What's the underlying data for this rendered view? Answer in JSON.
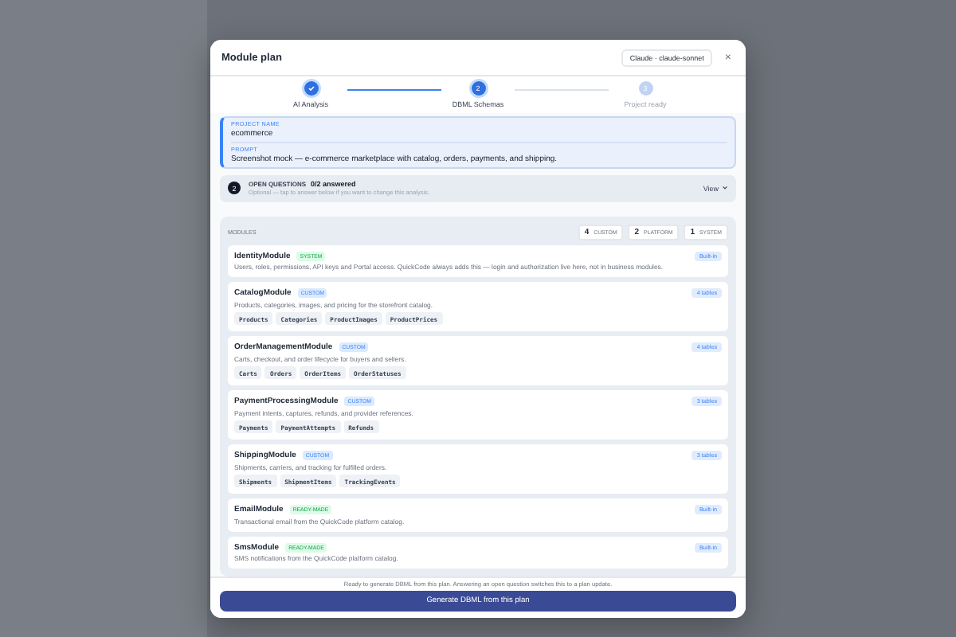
{
  "dialog": {
    "title": "Module plan",
    "model_chip": "Claude · claude-sonnet",
    "close": "×"
  },
  "steps": [
    {
      "label": "AI Analysis",
      "completed": true,
      "current": false
    },
    {
      "label": "DBML Schemas",
      "completed": false,
      "current": true,
      "number": "2"
    },
    {
      "label": "Project ready",
      "completed": false,
      "current": false,
      "number": "3"
    }
  ],
  "project": {
    "name_label": "PROJECT NAME",
    "name": "ecommerce",
    "prompt_label": "PROMPT",
    "prompt": "Screenshot mock — e-commerce marketplace with catalog, orders, payments, and shipping."
  },
  "open_questions": {
    "count": "2",
    "title": "OPEN QUESTIONS",
    "answered": "0/2 answered",
    "hint": "Optional — tap to answer below if you want to change this analysis.",
    "action": "View"
  },
  "modules": {
    "label": "MODULES",
    "counts": [
      {
        "number": "4",
        "label": "CUSTOM"
      },
      {
        "number": "2",
        "label": "PLATFORM"
      },
      {
        "number": "1",
        "label": "SYSTEM"
      }
    ],
    "items": [
      {
        "name": "IdentityModule",
        "kind": "system",
        "tag": "SYSTEM",
        "description": "Users, roles, permissions, API keys and Portal access. QuickCode always adds this — login and authorization live here, not in business modules.",
        "badge": "Built-in"
      },
      {
        "name": "CatalogModule",
        "kind": "custom",
        "tag": "CUSTOM",
        "description": "Products, categories, images, and pricing for the storefront catalog.",
        "badge": "4 tables",
        "tables": [
          "Products",
          "Categories",
          "ProductImages",
          "ProductPrices"
        ]
      },
      {
        "name": "OrderManagementModule",
        "kind": "custom",
        "tag": "CUSTOM",
        "description": "Carts, checkout, and order lifecycle for buyers and sellers.",
        "badge": "4 tables",
        "tables": [
          "Carts",
          "Orders",
          "OrderItems",
          "OrderStatuses"
        ]
      },
      {
        "name": "PaymentProcessingModule",
        "kind": "custom",
        "tag": "CUSTOM",
        "description": "Payment intents, captures, refunds, and provider references.",
        "badge": "3 tables",
        "tables": [
          "Payments",
          "PaymentAttempts",
          "Refunds"
        ]
      },
      {
        "name": "ShippingModule",
        "kind": "custom",
        "tag": "CUSTOM",
        "description": "Shipments, carriers, and tracking for fulfilled orders.",
        "badge": "3 tables",
        "tables": [
          "Shipments",
          "ShipmentItems",
          "TrackingEvents"
        ]
      },
      {
        "name": "EmailModule",
        "kind": "ready",
        "tag": "READY-MADE",
        "description": "Transactional email from the QuickCode platform catalog.",
        "badge": "Built-in"
      },
      {
        "name": "SmsModule",
        "kind": "ready",
        "tag": "READY-MADE",
        "description": "SMS notifications from the QuickCode platform catalog.",
        "badge": "Built-in"
      }
    ]
  },
  "footer": {
    "note": "Ready to generate DBML from this plan. Answering an open question switches this to a plan update.",
    "button": "Generate DBML from this plan"
  }
}
